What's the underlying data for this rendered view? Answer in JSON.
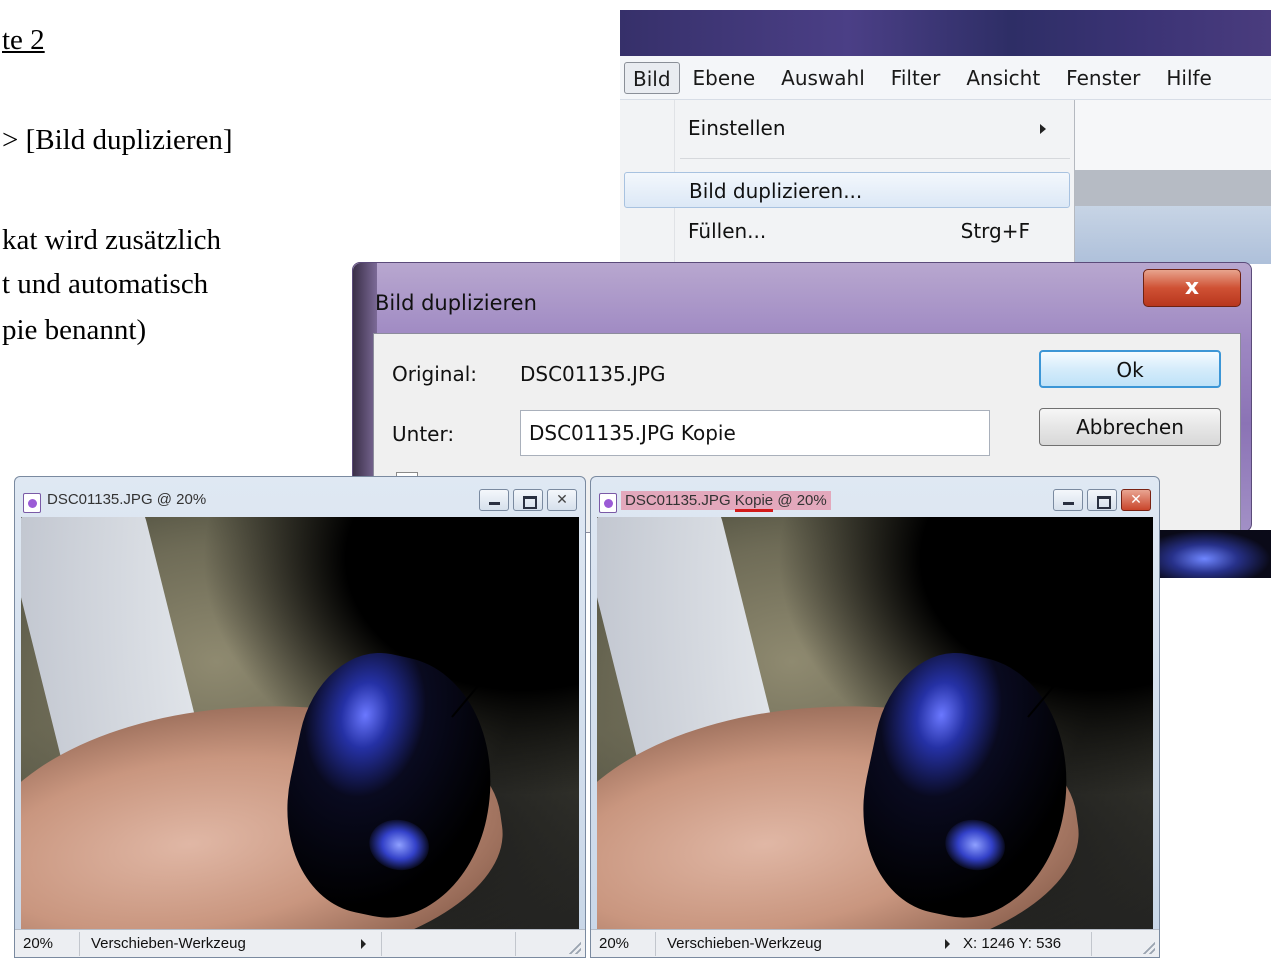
{
  "slide": {
    "heading": "te 2",
    "step": "> [Bild duplizieren]",
    "note_line1": "kat wird zusätzlich",
    "note_line2": "t und automatisch",
    "note_line3": "pie benannt)"
  },
  "menubar": {
    "items": [
      "Bild",
      "Ebene",
      "Auswahl",
      "Filter",
      "Ansicht",
      "Fenster",
      "Hilfe"
    ],
    "active": "Bild"
  },
  "dropdown": {
    "einstellen": "Einstellen",
    "duplizieren": "Bild duplizieren...",
    "fuellen": "Füllen...",
    "fuellen_shortcut": "Strg+F"
  },
  "dialog": {
    "title": "Bild duplizieren",
    "close_glyph": "x",
    "original_label": "Original:",
    "original_value": "DSC01135.JPG",
    "unter_label": "Unter:",
    "unter_value": "DSC01135.JPG Kopie",
    "ok_label": "Ok",
    "cancel_label": "Abbrechen"
  },
  "window_original": {
    "title": "DSC01135.JPG @ 20%",
    "zoom": "20%",
    "tool": "Verschieben-Werkzeug",
    "close_glyph": "✕"
  },
  "window_copy": {
    "title_prefix": "DSC01135.JPG ",
    "title_kopie": "Kopie",
    "title_suffix": " @ 20%",
    "zoom": "20%",
    "tool": "Verschieben-Werkzeug",
    "coords": "X: 1246  Y: 536",
    "close_glyph": "✕"
  },
  "colors": {
    "dialog_frame": "#9d87c2",
    "close_red": "#cf5134",
    "ok_border": "#3c96d6",
    "kopie_highlight": "#e3a8bc",
    "kopie_underline": "#d21a1a"
  }
}
